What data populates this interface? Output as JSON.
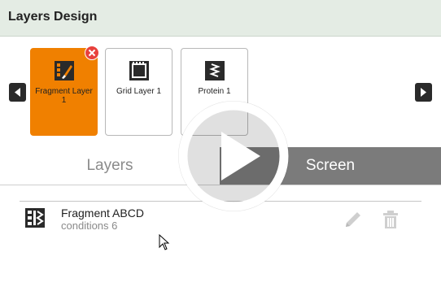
{
  "header": {
    "title": "Layers Design"
  },
  "carousel": {
    "cards": [
      {
        "label": "Fragment Layer 1",
        "icon": "fragment-brush-icon",
        "active": true
      },
      {
        "label": "Grid Layer 1",
        "icon": "grid-icon",
        "active": false
      },
      {
        "label": "Protein 1",
        "icon": "protein-icon",
        "active": false
      }
    ]
  },
  "tabs": [
    {
      "label": "Layers",
      "active": false
    },
    {
      "label": "Screen",
      "active": true
    }
  ],
  "layers_list": [
    {
      "name": "Fragment ABCD",
      "subtitle": "conditions 6",
      "icon": "fragment-layer-icon"
    }
  ],
  "colors": {
    "accent": "#f08000",
    "header_bg": "#e4ece4",
    "remove_badge": "#e8413c",
    "tab_active_bg": "#7b7b7b"
  },
  "overlay": {
    "icon": "play-icon"
  }
}
